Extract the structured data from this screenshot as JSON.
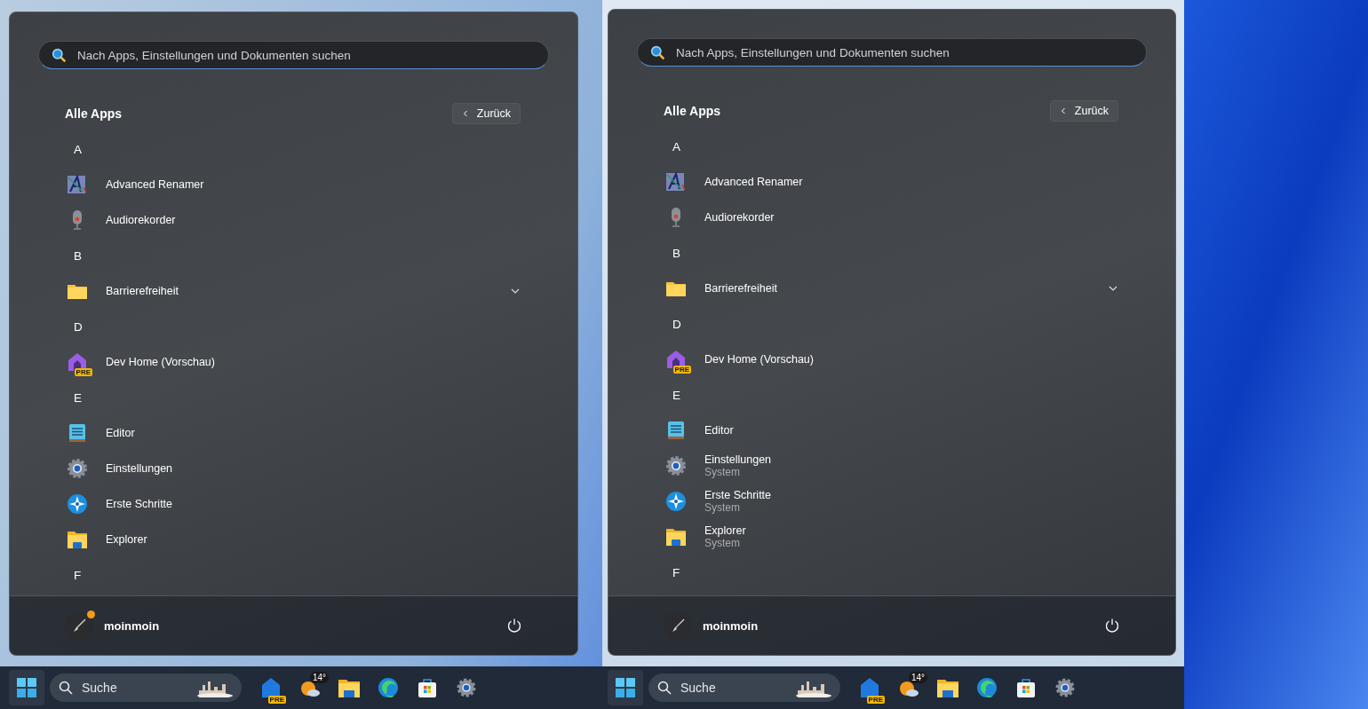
{
  "screens": [
    {
      "start_menu": {
        "search": {
          "placeholder": "Nach Apps, Einstellungen und Dokumenten suchen"
        },
        "title": "Alle Apps",
        "back_button": "Zurück",
        "sections": [
          {
            "letter": "A",
            "apps": [
              {
                "name": "Advanced Renamer",
                "kind": "renamer",
                "expandable": false
              },
              {
                "name": "Audiorekorder",
                "kind": "recorder",
                "expandable": false
              }
            ]
          },
          {
            "letter": "B",
            "apps": [
              {
                "name": "Barrierefreiheit",
                "kind": "folder",
                "expandable": true
              }
            ]
          },
          {
            "letter": "D",
            "apps": [
              {
                "name": "Dev Home (Vorschau)",
                "kind": "devhome",
                "badge": "PRE",
                "expandable": false
              }
            ]
          },
          {
            "letter": "E",
            "apps": [
              {
                "name": "Editor",
                "kind": "editor",
                "expandable": false
              },
              {
                "name": "Einstellungen",
                "kind": "settings",
                "expandable": false
              },
              {
                "name": "Erste Schritte",
                "kind": "getstarted",
                "expandable": false
              },
              {
                "name": "Explorer",
                "kind": "explorer",
                "expandable": false
              }
            ]
          },
          {
            "letter": "F"
          }
        ],
        "user": {
          "name": "moinmoin",
          "notification": true
        }
      },
      "taskbar": {
        "search": {
          "placeholder": "Suche"
        },
        "app_badge": "PRE",
        "weather": "14°"
      }
    },
    {
      "start_menu": {
        "search": {
          "placeholder": "Nach Apps, Einstellungen und Dokumenten suchen"
        },
        "title": "Alle Apps",
        "back_button": "Zurück",
        "sections": [
          {
            "letter": "A",
            "apps": [
              {
                "name": "Advanced Renamer",
                "kind": "renamer",
                "expandable": false
              },
              {
                "name": "Audiorekorder",
                "kind": "recorder",
                "expandable": false
              }
            ]
          },
          {
            "letter": "B",
            "apps": [
              {
                "name": "Barrierefreiheit",
                "kind": "folder",
                "expandable": true
              }
            ]
          },
          {
            "letter": "D",
            "apps": [
              {
                "name": "Dev Home (Vorschau)",
                "kind": "devhome",
                "badge": "PRE",
                "expandable": false
              }
            ]
          },
          {
            "letter": "E",
            "apps": [
              {
                "name": "Editor",
                "kind": "editor",
                "expandable": false
              },
              {
                "name": "Einstellungen",
                "subtitle": "System",
                "kind": "settings",
                "expandable": false
              },
              {
                "name": "Erste Schritte",
                "subtitle": "System",
                "kind": "getstarted",
                "expandable": false
              },
              {
                "name": "Explorer",
                "subtitle": "System",
                "kind": "explorer",
                "expandable": false
              }
            ]
          },
          {
            "letter": "F"
          }
        ],
        "user": {
          "name": "moinmoin",
          "notification": false
        }
      },
      "taskbar": {
        "search": {
          "placeholder": "Suche"
        },
        "app_badge": "PRE",
        "weather": "14°"
      }
    }
  ]
}
